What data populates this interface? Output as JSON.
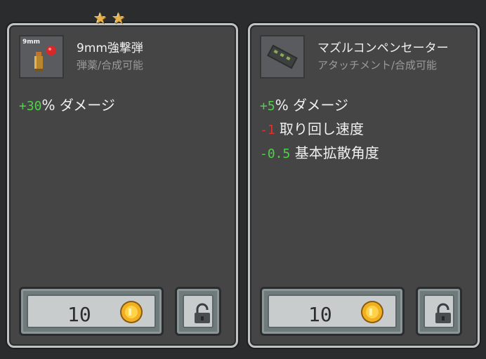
{
  "cards": [
    {
      "stars": [
        "★",
        "★"
      ],
      "thumb_tag": "9mm",
      "thumb_icon": "bullet-icon",
      "name": "9mm強撃弾",
      "subtitle": "弾薬/合成可能",
      "stats": [
        {
          "value": "+30",
          "suffix": "% ダメージ",
          "kind": "pos"
        }
      ],
      "price": "10",
      "coin_color": "#f0b020"
    },
    {
      "stars": [],
      "thumb_icon": "muzzle-compensator-icon",
      "name": "マズルコンペンセーター",
      "subtitle": "アタッチメント/合成可能",
      "stats": [
        {
          "value": "+5",
          "suffix": "% ダメージ",
          "kind": "pos"
        },
        {
          "value": "-1",
          "suffix": " 取り回し速度",
          "kind": "neg"
        },
        {
          "value": "-0.5",
          "suffix": " 基本拡散角度",
          "kind": "pos"
        }
      ],
      "price": "10",
      "coin_color": "#f0b020"
    }
  ],
  "colors": {
    "positive": "#4fd14a",
    "negative": "#e5302b",
    "star": "#e8b24a"
  }
}
